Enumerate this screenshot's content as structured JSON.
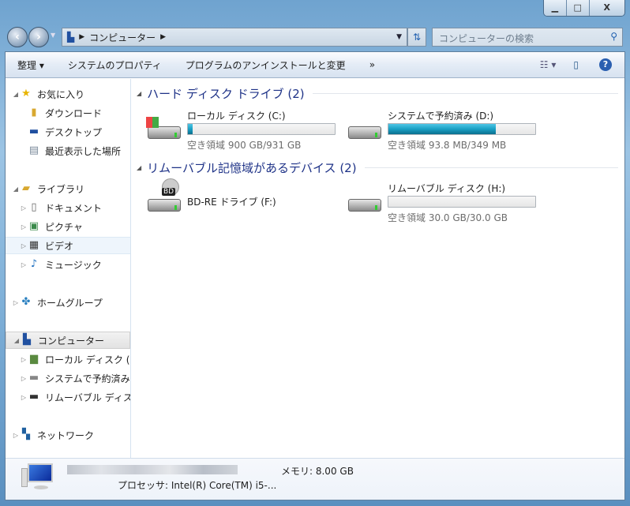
{
  "window": {
    "minimize": "▁",
    "maximize": "□",
    "close": "X"
  },
  "address": {
    "crumb": "コンピューター",
    "search_placeholder": "コンピューターの検索"
  },
  "toolbar": {
    "organize": "整理 ▾",
    "system_properties": "システムのプロパティ",
    "uninstall": "プログラムのアンインストールと変更",
    "more": "»"
  },
  "nav": [
    {
      "label": "お気に入り",
      "icon": "star-icon",
      "glyph": "★",
      "color": "#e8b400",
      "arrow": "◢",
      "indent": 0
    },
    {
      "label": "ダウンロード",
      "icon": "download-folder-icon",
      "glyph": "▮",
      "color": "#d8a830",
      "arrow": "",
      "indent": 1
    },
    {
      "label": "デスクトップ",
      "icon": "desktop-icon",
      "glyph": "▬",
      "color": "#2050a0",
      "arrow": "",
      "indent": 1
    },
    {
      "label": "最近表示した場所",
      "icon": "recent-places-icon",
      "glyph": "▤",
      "color": "#7a8a9a",
      "arrow": "",
      "indent": 1
    },
    {
      "label": "ライブラリ",
      "icon": "library-icon",
      "glyph": "▰",
      "color": "#d8a830",
      "arrow": "◢",
      "indent": 0
    },
    {
      "label": "ドキュメント",
      "icon": "documents-icon",
      "glyph": "▯",
      "color": "#666",
      "arrow": "▷",
      "indent": 1
    },
    {
      "label": "ピクチャ",
      "icon": "pictures-icon",
      "glyph": "▣",
      "color": "#3a8a4a",
      "arrow": "▷",
      "indent": 1
    },
    {
      "label": "ビデオ",
      "icon": "video-icon",
      "glyph": "▦",
      "color": "#333",
      "arrow": "▷",
      "indent": 1
    },
    {
      "label": "ミュージック",
      "icon": "music-icon",
      "glyph": "♪",
      "color": "#2070c0",
      "arrow": "▷",
      "indent": 1
    },
    {
      "label": "ホームグループ",
      "icon": "homegroup-icon",
      "glyph": "✤",
      "color": "#2a80c0",
      "arrow": "▷",
      "indent": 0
    },
    {
      "label": "コンピューター",
      "icon": "computer-icon",
      "glyph": "▙",
      "color": "#2050a0",
      "arrow": "◢",
      "indent": 0
    },
    {
      "label": "ローカル ディスク (C:)",
      "icon": "local-disk-icon",
      "glyph": "▆",
      "color": "#5a8a40",
      "arrow": "▷",
      "indent": 1
    },
    {
      "label": "システムで予約済み (D:)",
      "icon": "drive-icon",
      "glyph": "▬",
      "color": "#888",
      "arrow": "▷",
      "indent": 1
    },
    {
      "label": "リムーバブル ディスク (H:)",
      "icon": "removable-drive-icon",
      "glyph": "▬",
      "color": "#333",
      "arrow": "▷",
      "indent": 1
    },
    {
      "label": "ネットワーク",
      "icon": "network-icon",
      "glyph": "▚",
      "color": "#2060a0",
      "arrow": "▷",
      "indent": 0
    }
  ],
  "groups": [
    {
      "title": "ハード ディスク ドライブ (2)",
      "drives": [
        {
          "name": "ローカル ディスク (C:)",
          "free": "空き領域 900 GB/931 GB",
          "used_fraction": 0.033,
          "icon": "windows-hard-drive-icon"
        },
        {
          "name": "システムで予約済み (D:)",
          "free": "空き領域 93.8 MB/349 MB",
          "used_fraction": 0.73,
          "icon": "hard-drive-icon"
        }
      ]
    },
    {
      "title": "リムーバブル記憶域があるデバイス (2)",
      "drives": [
        {
          "name": "BD-RE ドライブ (F:)",
          "icon": "bd-drive-icon",
          "badge": "BD"
        },
        {
          "name": "リムーバブル ディスク (H:)",
          "free": "空き領域 30.0 GB/30.0 GB",
          "used_fraction": 0.0,
          "icon": "removable-drive-icon"
        }
      ]
    }
  ],
  "status": {
    "memory": "メモリ: 8.00 GB",
    "processor": "プロセッサ: Intel(R) Core(TM) i5-..."
  }
}
